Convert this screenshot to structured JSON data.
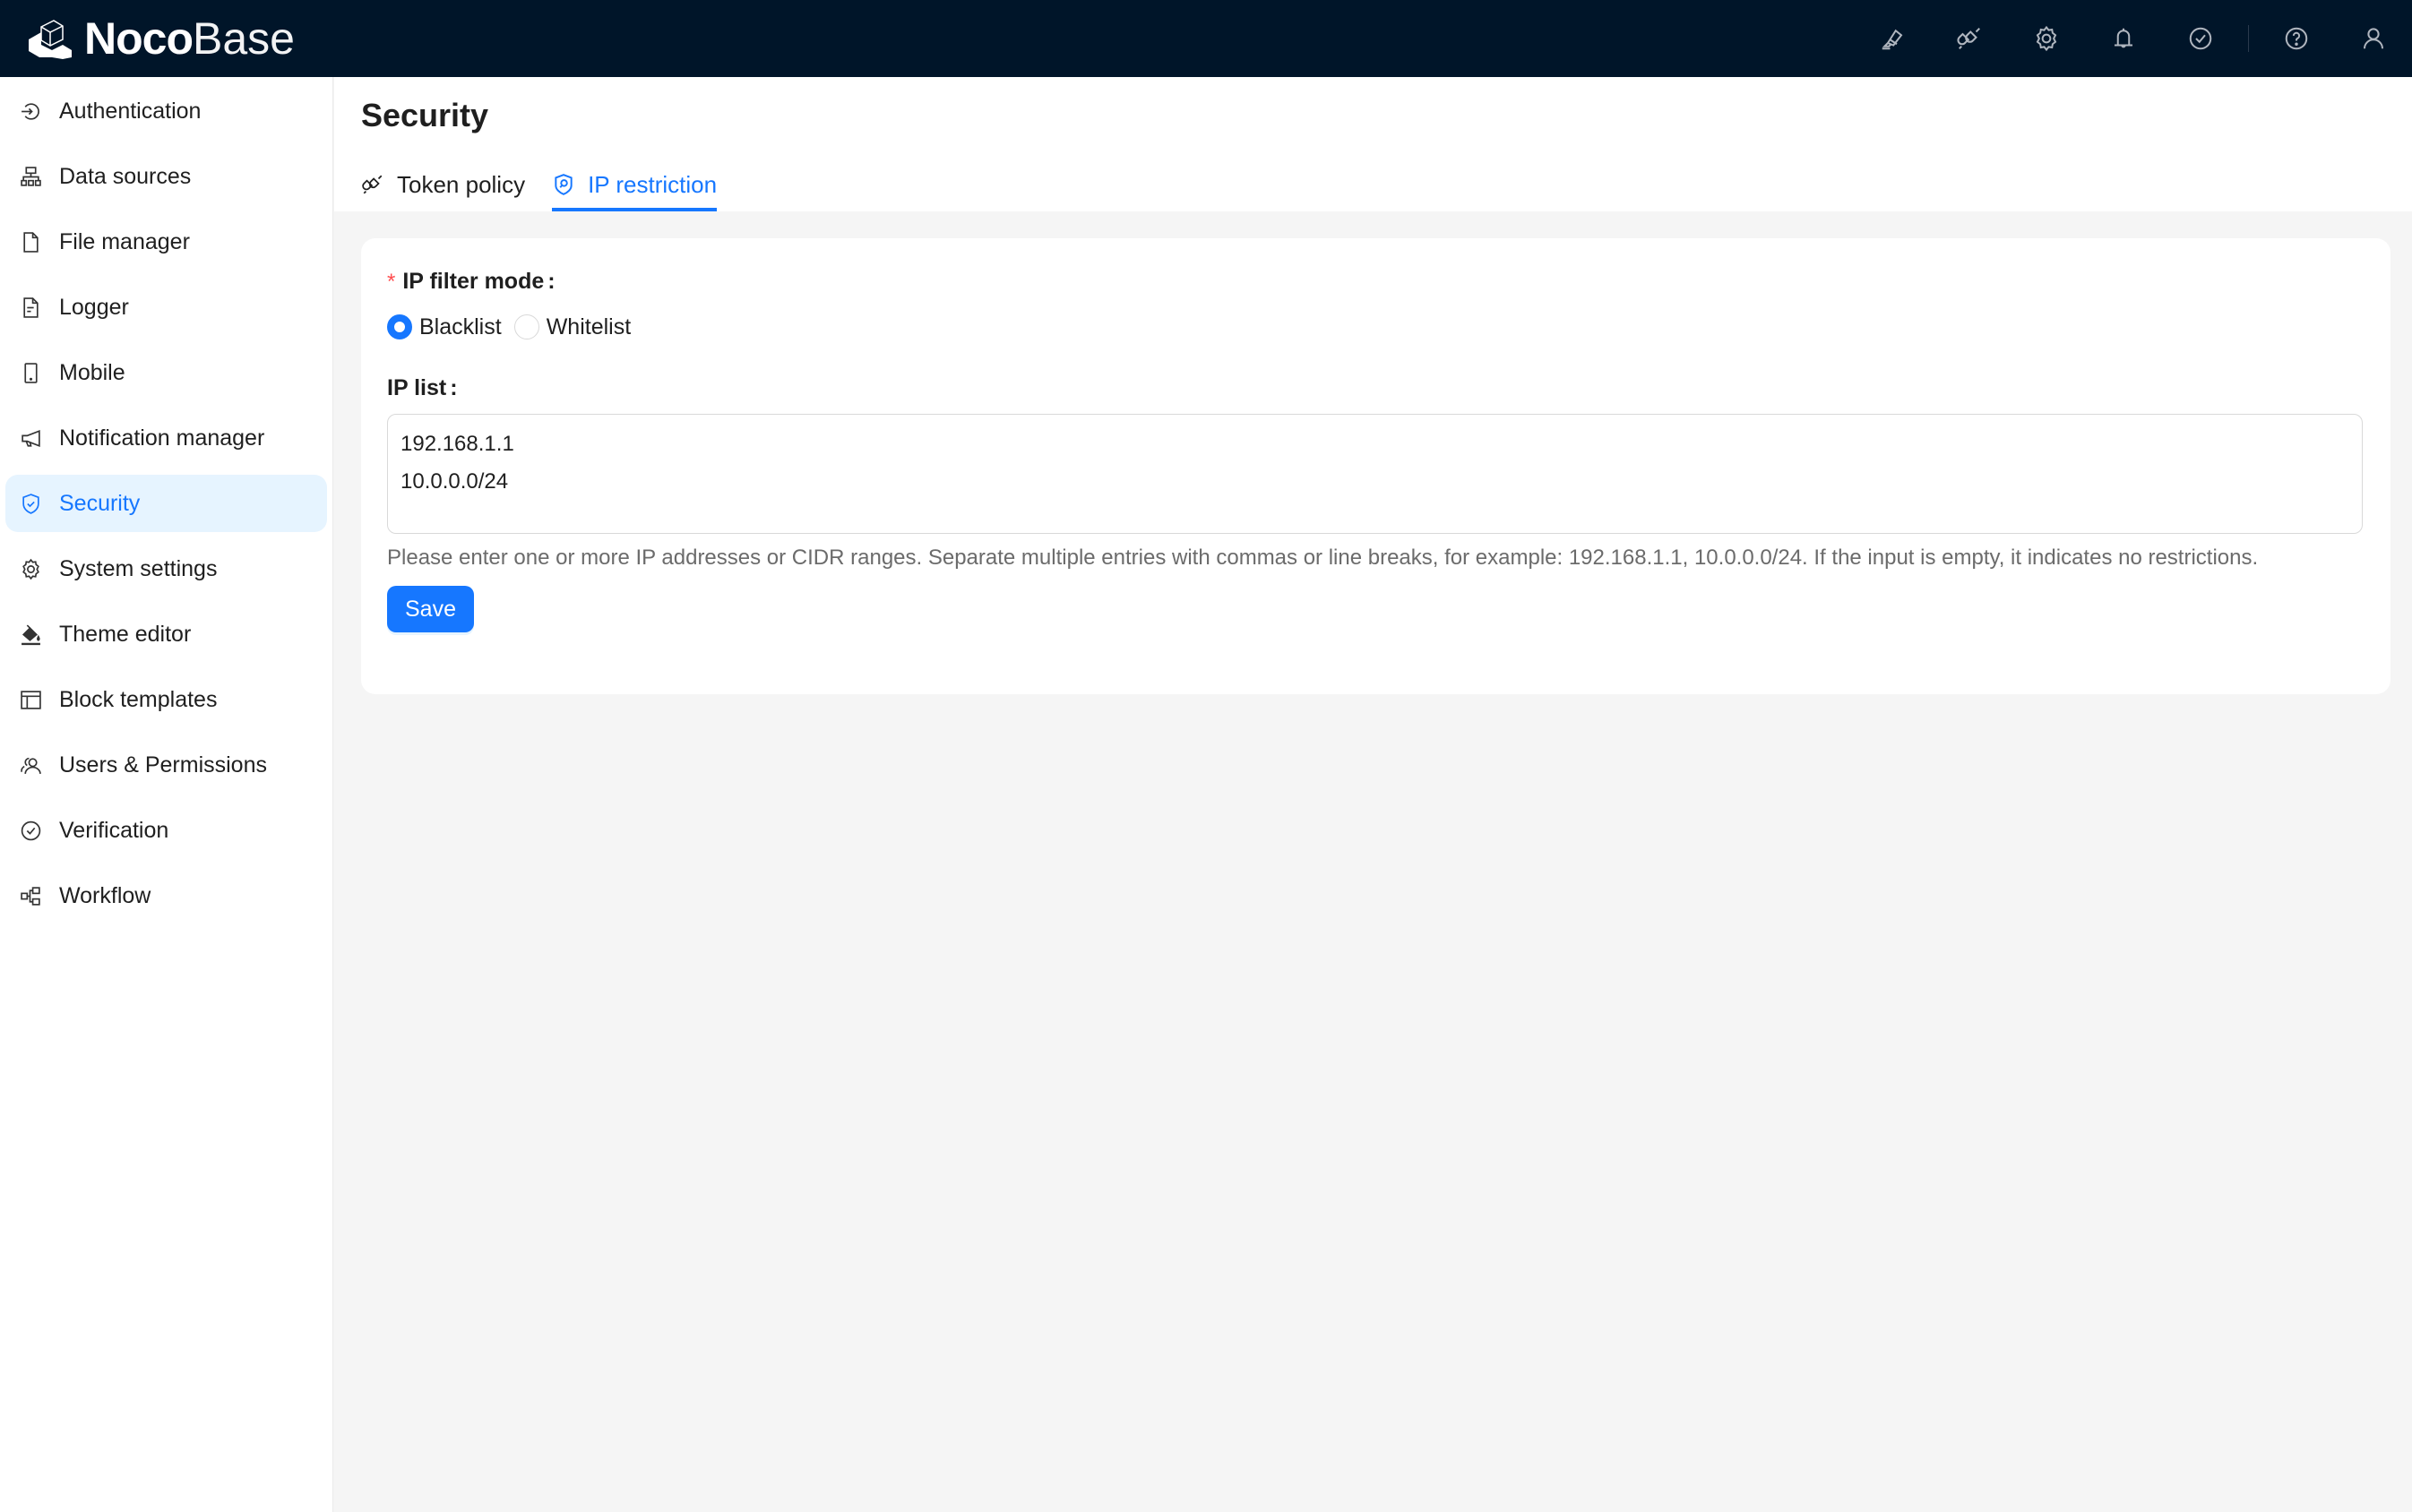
{
  "app": {
    "brand_bold": "Noco",
    "brand_light": "Base"
  },
  "topbar": {
    "icons": [
      "theme-brush-icon",
      "plugin-plug-icon",
      "settings-gear-icon",
      "notification-bell-icon",
      "tasks-check-icon",
      "help-icon",
      "user-icon"
    ]
  },
  "sidebar": {
    "items": [
      {
        "label": "Authentication",
        "icon": "login-icon"
      },
      {
        "label": "Data sources",
        "icon": "cluster-icon"
      },
      {
        "label": "File manager",
        "icon": "file-icon"
      },
      {
        "label": "Logger",
        "icon": "file-text-icon"
      },
      {
        "label": "Mobile",
        "icon": "mobile-icon"
      },
      {
        "label": "Notification manager",
        "icon": "megaphone-icon"
      },
      {
        "label": "Security",
        "icon": "safety-icon",
        "active": true
      },
      {
        "label": "System settings",
        "icon": "setting-icon"
      },
      {
        "label": "Theme editor",
        "icon": "bg-colors-icon"
      },
      {
        "label": "Block templates",
        "icon": "layout-icon"
      },
      {
        "label": "Users & Permissions",
        "icon": "team-icon"
      },
      {
        "label": "Verification",
        "icon": "check-circle-icon"
      },
      {
        "label": "Workflow",
        "icon": "partition-icon"
      }
    ]
  },
  "page": {
    "title": "Security",
    "tabs": [
      {
        "label": "Token policy",
        "icon": "api-plug-icon",
        "active": false
      },
      {
        "label": "IP restriction",
        "icon": "shield-search-icon",
        "active": true
      }
    ]
  },
  "form": {
    "filter_mode_label": "IP filter mode",
    "required_mark": "*",
    "colon": ":",
    "options": [
      {
        "label": "Blacklist",
        "checked": true
      },
      {
        "label": "Whitelist",
        "checked": false
      }
    ],
    "ip_list_label": "IP list",
    "ip_list_value": "192.168.1.1\n10.0.0.0/24",
    "help_text": "Please enter one or more IP addresses or CIDR ranges. Separate multiple entries with commas or line breaks, for example: 192.168.1.1, 10.0.0.0/24. If the input is empty, it indicates no restrictions.",
    "save_label": "Save"
  },
  "colors": {
    "primary": "#1677ff",
    "header_bg": "#001529",
    "active_bg": "#e6f4ff",
    "required": "#ff4d4f"
  }
}
